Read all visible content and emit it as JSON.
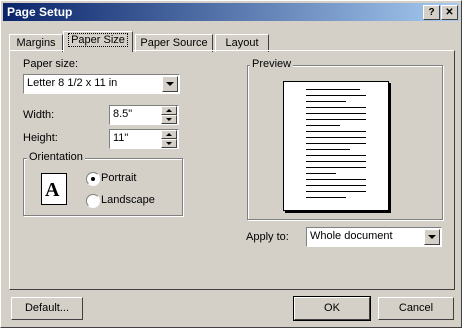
{
  "window": {
    "title": "Page Setup",
    "help": "?",
    "close": "✕"
  },
  "tabs": [
    {
      "label": "Margins"
    },
    {
      "label": "Paper Size"
    },
    {
      "label": "Paper Source"
    },
    {
      "label": "Layout"
    }
  ],
  "paper_size": {
    "label": "Paper size:",
    "value": "Letter 8 1/2 x 11 in"
  },
  "width": {
    "label": "Width:",
    "value": "8.5\""
  },
  "height": {
    "label": "Height:",
    "value": "11\""
  },
  "orientation": {
    "title": "Orientation",
    "icon_letter": "A",
    "options": [
      {
        "label": "Portrait",
        "selected": true
      },
      {
        "label": "Landscape",
        "selected": false
      }
    ]
  },
  "preview": {
    "title": "Preview"
  },
  "apply_to": {
    "label": "Apply to:",
    "value": "Whole document"
  },
  "buttons": {
    "default": "Default...",
    "ok": "OK",
    "cancel": "Cancel"
  }
}
